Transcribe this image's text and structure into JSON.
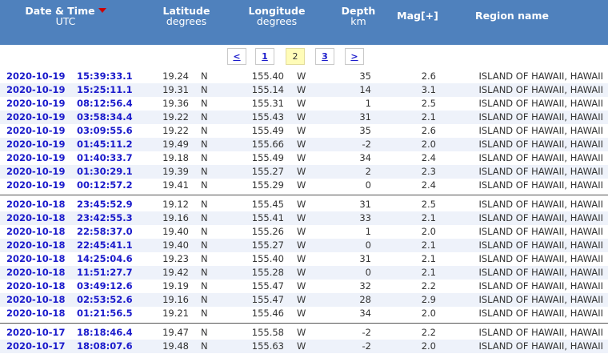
{
  "header": {
    "datetime_label": "Date & Time",
    "datetime_sub": "UTC",
    "latitude_label": "Latitude",
    "latitude_sub": "degrees",
    "longitude_label": "Longitude",
    "longitude_sub": "degrees",
    "depth_label": "Depth",
    "depth_sub": "km",
    "mag_label": "Mag[+]",
    "region_label": "Region name"
  },
  "pager": {
    "prev": "<",
    "pages": [
      "1",
      "2",
      "3"
    ],
    "current": "2",
    "next": ">"
  },
  "groups": [
    [
      {
        "date": "2020-10-19",
        "time": "15:39:33.1",
        "lat": "19.24",
        "lat_dir": "N",
        "lon": "155.40",
        "lon_dir": "W",
        "depth": "35",
        "mag": "2.6",
        "region": "ISLAND OF HAWAII, HAWAII"
      },
      {
        "date": "2020-10-19",
        "time": "15:25:11.1",
        "lat": "19.31",
        "lat_dir": "N",
        "lon": "155.14",
        "lon_dir": "W",
        "depth": "14",
        "mag": "3.1",
        "region": "ISLAND OF HAWAII, HAWAII"
      },
      {
        "date": "2020-10-19",
        "time": "08:12:56.4",
        "lat": "19.36",
        "lat_dir": "N",
        "lon": "155.31",
        "lon_dir": "W",
        "depth": "1",
        "mag": "2.5",
        "region": "ISLAND OF HAWAII, HAWAII"
      },
      {
        "date": "2020-10-19",
        "time": "03:58:34.4",
        "lat": "19.22",
        "lat_dir": "N",
        "lon": "155.43",
        "lon_dir": "W",
        "depth": "31",
        "mag": "2.1",
        "region": "ISLAND OF HAWAII, HAWAII"
      },
      {
        "date": "2020-10-19",
        "time": "03:09:55.6",
        "lat": "19.22",
        "lat_dir": "N",
        "lon": "155.49",
        "lon_dir": "W",
        "depth": "35",
        "mag": "2.6",
        "region": "ISLAND OF HAWAII, HAWAII"
      },
      {
        "date": "2020-10-19",
        "time": "01:45:11.2",
        "lat": "19.49",
        "lat_dir": "N",
        "lon": "155.66",
        "lon_dir": "W",
        "depth": "-2",
        "mag": "2.0",
        "region": "ISLAND OF HAWAII, HAWAII"
      },
      {
        "date": "2020-10-19",
        "time": "01:40:33.7",
        "lat": "19.18",
        "lat_dir": "N",
        "lon": "155.49",
        "lon_dir": "W",
        "depth": "34",
        "mag": "2.4",
        "region": "ISLAND OF HAWAII, HAWAII"
      },
      {
        "date": "2020-10-19",
        "time": "01:30:29.1",
        "lat": "19.39",
        "lat_dir": "N",
        "lon": "155.27",
        "lon_dir": "W",
        "depth": "2",
        "mag": "2.3",
        "region": "ISLAND OF HAWAII, HAWAII"
      },
      {
        "date": "2020-10-19",
        "time": "00:12:57.2",
        "lat": "19.41",
        "lat_dir": "N",
        "lon": "155.29",
        "lon_dir": "W",
        "depth": "0",
        "mag": "2.4",
        "region": "ISLAND OF HAWAII, HAWAII"
      }
    ],
    [
      {
        "date": "2020-10-18",
        "time": "23:45:52.9",
        "lat": "19.12",
        "lat_dir": "N",
        "lon": "155.45",
        "lon_dir": "W",
        "depth": "31",
        "mag": "2.5",
        "region": "ISLAND OF HAWAII, HAWAII"
      },
      {
        "date": "2020-10-18",
        "time": "23:42:55.3",
        "lat": "19.16",
        "lat_dir": "N",
        "lon": "155.41",
        "lon_dir": "W",
        "depth": "33",
        "mag": "2.1",
        "region": "ISLAND OF HAWAII, HAWAII"
      },
      {
        "date": "2020-10-18",
        "time": "22:58:37.0",
        "lat": "19.40",
        "lat_dir": "N",
        "lon": "155.26",
        "lon_dir": "W",
        "depth": "1",
        "mag": "2.0",
        "region": "ISLAND OF HAWAII, HAWAII"
      },
      {
        "date": "2020-10-18",
        "time": "22:45:41.1",
        "lat": "19.40",
        "lat_dir": "N",
        "lon": "155.27",
        "lon_dir": "W",
        "depth": "0",
        "mag": "2.1",
        "region": "ISLAND OF HAWAII, HAWAII"
      },
      {
        "date": "2020-10-18",
        "time": "14:25:04.6",
        "lat": "19.23",
        "lat_dir": "N",
        "lon": "155.40",
        "lon_dir": "W",
        "depth": "31",
        "mag": "2.1",
        "region": "ISLAND OF HAWAII, HAWAII"
      },
      {
        "date": "2020-10-18",
        "time": "11:51:27.7",
        "lat": "19.42",
        "lat_dir": "N",
        "lon": "155.28",
        "lon_dir": "W",
        "depth": "0",
        "mag": "2.1",
        "region": "ISLAND OF HAWAII, HAWAII"
      },
      {
        "date": "2020-10-18",
        "time": "03:49:12.6",
        "lat": "19.19",
        "lat_dir": "N",
        "lon": "155.47",
        "lon_dir": "W",
        "depth": "32",
        "mag": "2.2",
        "region": "ISLAND OF HAWAII, HAWAII"
      },
      {
        "date": "2020-10-18",
        "time": "02:53:52.6",
        "lat": "19.16",
        "lat_dir": "N",
        "lon": "155.47",
        "lon_dir": "W",
        "depth": "28",
        "mag": "2.9",
        "region": "ISLAND OF HAWAII, HAWAII"
      },
      {
        "date": "2020-10-18",
        "time": "01:21:56.5",
        "lat": "19.21",
        "lat_dir": "N",
        "lon": "155.46",
        "lon_dir": "W",
        "depth": "34",
        "mag": "2.0",
        "region": "ISLAND OF HAWAII, HAWAII"
      }
    ],
    [
      {
        "date": "2020-10-17",
        "time": "18:18:46.4",
        "lat": "19.47",
        "lat_dir": "N",
        "lon": "155.58",
        "lon_dir": "W",
        "depth": "-2",
        "mag": "2.2",
        "region": "ISLAND OF HAWAII, HAWAII"
      },
      {
        "date": "2020-10-17",
        "time": "18:08:07.6",
        "lat": "19.48",
        "lat_dir": "N",
        "lon": "155.63",
        "lon_dir": "W",
        "depth": "-2",
        "mag": "2.0",
        "region": "ISLAND OF HAWAII, HAWAII"
      }
    ]
  ]
}
